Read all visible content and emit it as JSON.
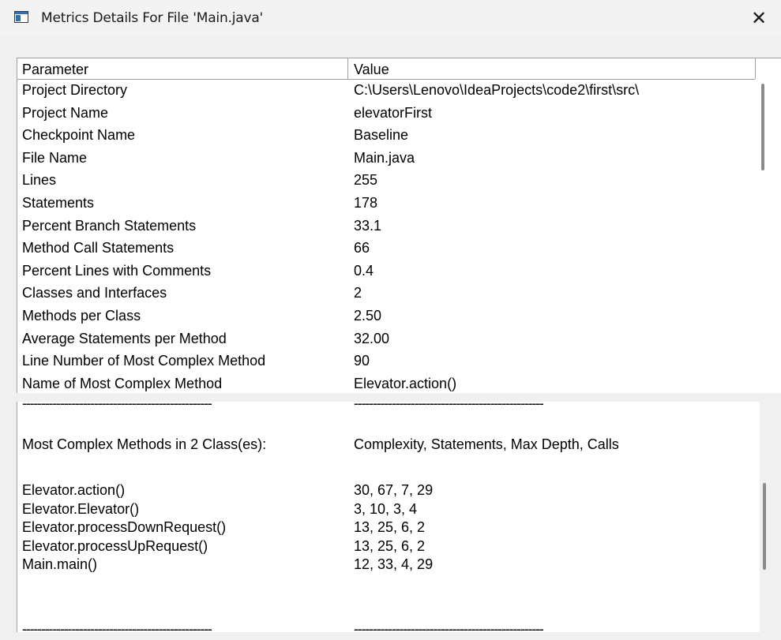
{
  "window": {
    "title": "Metrics Details For File 'Main.java'",
    "close_glyph": "✕"
  },
  "table": {
    "headers": {
      "parameter": "Parameter",
      "value": "Value"
    },
    "rows": [
      {
        "param": "Project Directory",
        "value": "C:\\Users\\Lenovo\\IdeaProjects\\code2\\first\\src\\"
      },
      {
        "param": "Project Name",
        "value": "elevatorFirst"
      },
      {
        "param": "Checkpoint Name",
        "value": "Baseline"
      },
      {
        "param": "File Name",
        "value": "Main.java"
      },
      {
        "param": "Lines",
        "value": "255"
      },
      {
        "param": "Statements",
        "value": "178"
      },
      {
        "param": "Percent Branch Statements",
        "value": "33.1"
      },
      {
        "param": "Method Call Statements",
        "value": "66"
      },
      {
        "param": "Percent Lines with Comments",
        "value": "0.4"
      },
      {
        "param": "Classes and Interfaces",
        "value": "2"
      },
      {
        "param": "Methods per Class",
        "value": "2.50"
      },
      {
        "param": "Average Statements per Method",
        "value": "32.00"
      },
      {
        "param": "Line Number of Most Complex Method",
        "value": "90"
      },
      {
        "param": "Name of Most Complex Method",
        "value": "Elevator.action()"
      }
    ]
  },
  "methods": {
    "separator_left": "--------------------------------------------------",
    "separator_right": "--------------------------------------------------",
    "heading_left": "Most Complex Methods in 2 Class(es):",
    "heading_right": "Complexity, Statements, Max Depth, Calls",
    "rows": [
      {
        "name": "Elevator.action()",
        "stats": "30, 67, 7, 29"
      },
      {
        "name": "Elevator.Elevator()",
        "stats": "3, 10, 3, 4"
      },
      {
        "name": "Elevator.processDownRequest()",
        "stats": "13, 25, 6, 2"
      },
      {
        "name": "Elevator.processUpRequest()",
        "stats": "13, 25, 6, 2"
      },
      {
        "name": "Main.main()",
        "stats": "12, 33, 4, 29"
      }
    ]
  },
  "icons": {
    "app": "window-icon",
    "close": "close-icon"
  }
}
